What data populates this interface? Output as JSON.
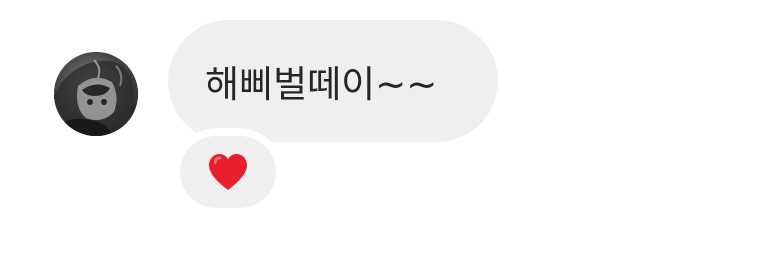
{
  "message": {
    "text": "해삐벌떼이~~"
  },
  "reaction": {
    "icon": "heart-icon",
    "color": "#e8202b"
  },
  "colors": {
    "bubble_background": "#efefef",
    "text": "#262626",
    "page_background": "#ffffff"
  }
}
